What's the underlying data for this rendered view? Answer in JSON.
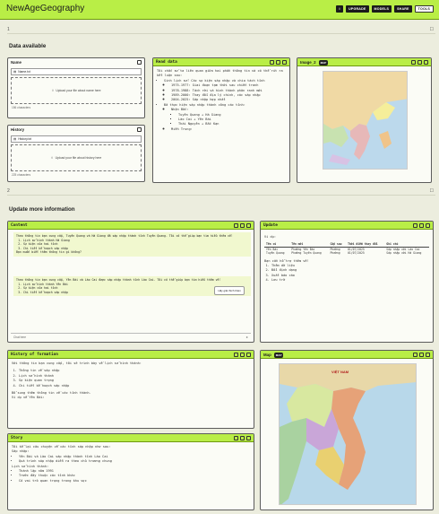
{
  "app": {
    "title": "NewAgeGeography",
    "toolbar": {
      "btn1": "UPGRADE",
      "btn2": "MODELS",
      "btn3": "SHARE",
      "btn4": "TOOLS"
    }
  },
  "sections": {
    "data_available": "Data available",
    "update_more": "Update more information",
    "marker1": "1",
    "marker2": "2"
  },
  "name_panel": {
    "title": "Name",
    "file": "Name.txt",
    "upload": "Upload your file about name here",
    "chars": "156 characters"
  },
  "history_panel": {
    "title": "History",
    "file": "History.txt",
    "upload": "Upload your file about history here",
    "chars": "225 characters"
  },
  "read_data": {
    "title": "Read data",
    "intro": "Tôi chắc sử ta liên quan giữa hai phần thông tin và có thể rút ra kết luận sau:",
    "items": [
      "Sinh lịch sử: Các sự kiện sáp nhập và chia tách tỉnh",
      "1975-1977: Giai đoạn tạm thời sau chiến tranh",
      "1978-1988: Tách rời và hình thành phân ranh mới",
      "1989-2000: Thay đổi địa lý chính, các sáp nhập",
      "2004-2025: Sáp nhập hợp nhất",
      "Đã thực hiện sáp nhập thành công các tỉnh:",
      "Nhận Bắc:",
      "Tuyên Quang + Hà Giang",
      "Lào Cai + Yên Bái",
      "Thái Nguyên + Bắc Kạn",
      "Miền Trung:"
    ]
  },
  "image2": {
    "title": "Image_2",
    "badge": "MAP"
  },
  "content": {
    "title": "Content",
    "msg1": "Theo thông tin bạn cung cấp, Tuyên Quang và Hà Giang đã sáp nhập thành tỉnh Tuyên Quang. Tôi có thể giúp bạn tìm hiểu thêm về:",
    "list1": [
      "Lịch sử hình thành Hà Giang",
      "Sự kiện của hai tỉnh",
      "Chi tiết kế hoạch sáp nhập"
    ],
    "ask1": "Bạn muốn biết thêm thông tin gì không?",
    "sugg": "Hãy giải thích thêm",
    "msg2": "Theo thông tin bạn cung cấp, Yên Bái và Lào Cai được sáp nhập thành tỉnh Lào Cai. Tôi có thể giúp bạn tìm hiểu thêm về:",
    "list2": [
      "Lịch sử hình thành Yên Bái",
      "Sự kiện của hai tỉnh",
      "Chi tiết kế hoạch sáp nhập"
    ],
    "ask2": "Bạn muốn biết thêm thông tin gì không?",
    "input": "Chat here"
  },
  "update": {
    "title": "Update",
    "headers": [
      "Tên cũ",
      "Tên mới",
      "Cấp sau",
      "Thời điểm thay đổi",
      "Ghi chú"
    ],
    "rows": [
      [
        "Yên Bái",
        "Phường Yên Bái",
        "Phường",
        "01/07/2025",
        "Sáp nhập với Lào Cai"
      ],
      [
        "Tuyên Quang",
        "Phường Tuyên Quang",
        "Phường",
        "01/07/2025",
        "Sáp nhập với Hà Giang"
      ]
    ],
    "example": "Ví dụ:",
    "note": "Bạn cần hỗ trợ thêm về:",
    "steps": [
      "Thêm dữ liệu",
      "Đổi định dạng",
      "Xuất báo cáo",
      "Lưu trữ"
    ]
  },
  "history_formation": {
    "title": "History of formation",
    "intro": "Với thông tin bạn cung cấp, tôi sẽ trình bày về lịch sử hình thành:",
    "items": [
      "Thông tin về sáp nhập",
      "Lịch sử hình thành",
      "Sự kiện quan trọng",
      "Chi tiết kế hoạch sáp nhập"
    ],
    "note": "Bổ sung thêm thông tin về các tỉnh thành.",
    "sub": "Ví dụ về Yên Bái:"
  },
  "map_panel": {
    "title": "Map",
    "badge": "MAP",
    "label": "VIỆT NAM"
  },
  "story": {
    "title": "Story",
    "intro": "Tôi kể lại câu chuyện về các tỉnh sáp nhập như sau:",
    "sub": "Sáp nhập:",
    "items": [
      "Yên Bái và Lào Cai sáp nhập thành tỉnh Lào Cai",
      "Quá trình sáp nhập diễn ra theo chủ trương chung"
    ],
    "title2": "Lịch sử hình thành:",
    "items2": [
      "Thành lập năm 1991",
      "Trước đây thuộc các tỉnh khác",
      "Có vai trò quan trọng trong khu vực"
    ]
  }
}
